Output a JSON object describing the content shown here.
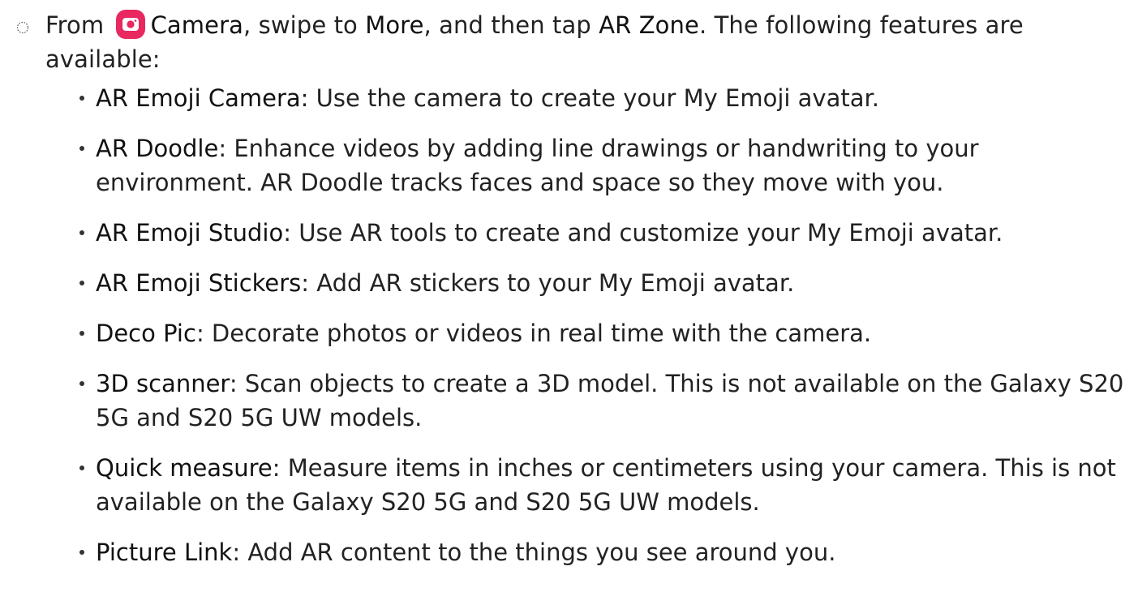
{
  "step": {
    "prefix": "From ",
    "camera_icon": "camera-app-icon",
    "camera_label": "Camera",
    "mid1": ", swipe to ",
    "more_label": "More",
    "mid2": ", and then tap ",
    "ar_zone_label": "AR Zone",
    "suffix": ". The following features are available:"
  },
  "features": [
    {
      "name": "AR Emoji Camera",
      "desc": ": Use the camera to create your My Emoji avatar."
    },
    {
      "name": "AR Doodle",
      "desc": ": Enhance videos by adding line drawings or handwriting to your environment. AR Doodle tracks faces and space so they move with you."
    },
    {
      "name": "AR Emoji Studio",
      "desc": ": Use AR tools to create and customize your My Emoji avatar."
    },
    {
      "name": "AR Emoji Stickers",
      "desc": ": Add AR stickers to your My Emoji avatar."
    },
    {
      "name": "Deco Pic",
      "desc": ": Decorate photos or videos in real time with the camera."
    },
    {
      "name": "3D scanner",
      "desc": ": Scan objects to create a 3D model. This is not available on the Galaxy S20 5G and S20 5G UW models."
    },
    {
      "name": "Quick measure",
      "desc": ": Measure items in inches or centimeters using your camera. This is not available on the Galaxy S20 5G and S20 5G UW models."
    },
    {
      "name": "Picture Link",
      "desc": ": Add AR content to the things you see around you."
    }
  ],
  "colors": {
    "camera_icon_bg": "#e8285f",
    "text": "#222222"
  }
}
